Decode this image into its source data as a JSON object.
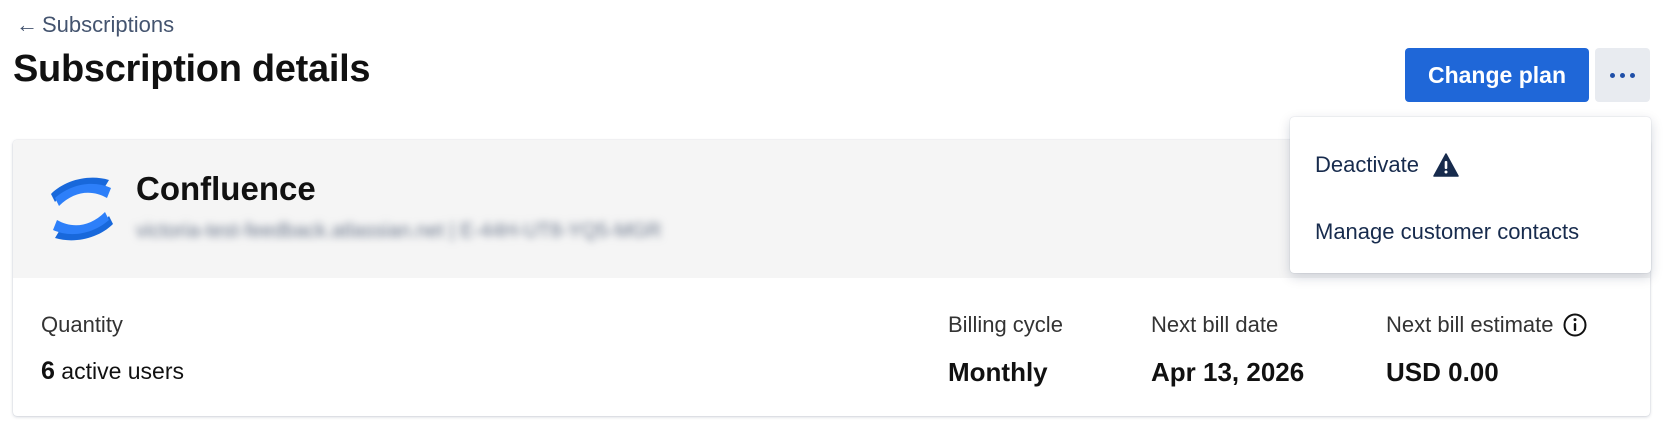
{
  "breadcrumb": {
    "back_label": "Subscriptions"
  },
  "header": {
    "title": "Subscription details",
    "primary_button": "Change plan",
    "more_button": "more-options-icon"
  },
  "product": {
    "name": "Confluence",
    "meta": "victoria-test-feedback.atlassian.net | E-44H-UT8-YQ5-MGR",
    "logo": "confluence-logo"
  },
  "metrics": {
    "quantity": {
      "label": "Quantity",
      "value_number": "6",
      "value_suffix": "active users"
    },
    "billing_cycle": {
      "label": "Billing cycle",
      "value": "Monthly"
    },
    "next_bill_date": {
      "label": "Next bill date",
      "value": "Apr 13, 2026"
    },
    "next_bill_estimate": {
      "label": "Next bill estimate",
      "value": "USD 0.00",
      "icon": "info-icon"
    }
  },
  "dropdown": {
    "items": [
      {
        "label": "Deactivate",
        "icon": "warning-icon"
      },
      {
        "label": "Manage customer contacts"
      }
    ]
  },
  "colors": {
    "primary": "#1f67d8",
    "header_bg": "#f5f5f5",
    "logo_blue": "#2d7ff9"
  }
}
